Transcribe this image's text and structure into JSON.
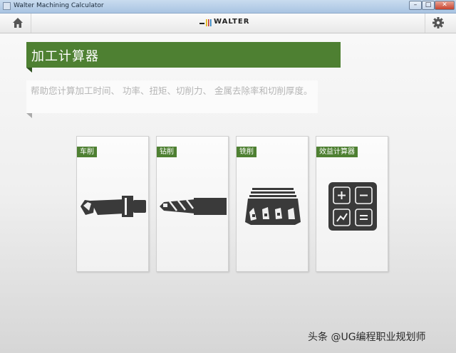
{
  "window": {
    "title": "Walter Machining Calculator",
    "minimize": "–",
    "maximize": "□",
    "close": "✕"
  },
  "toolbar": {
    "home_icon": "home-icon",
    "settings_icon": "gear-icon",
    "logo_text": "WALTER"
  },
  "banner": {
    "title": "加工计算器"
  },
  "description": "帮助您计算加工时间、 功率、扭矩、切削力、 金属去除率和切削厚度。",
  "cards": [
    {
      "label": "车削",
      "icon": "turning-tool-icon"
    },
    {
      "label": "钻削",
      "icon": "drill-icon"
    },
    {
      "label": "铣削",
      "icon": "milling-cutter-icon"
    },
    {
      "label": "效益计算器",
      "icon": "calculator-icon"
    }
  ],
  "watermark": "头条 @UG编程职业规划师",
  "colors": {
    "accent": "#4e8032",
    "icon": "#3a3a3a"
  }
}
